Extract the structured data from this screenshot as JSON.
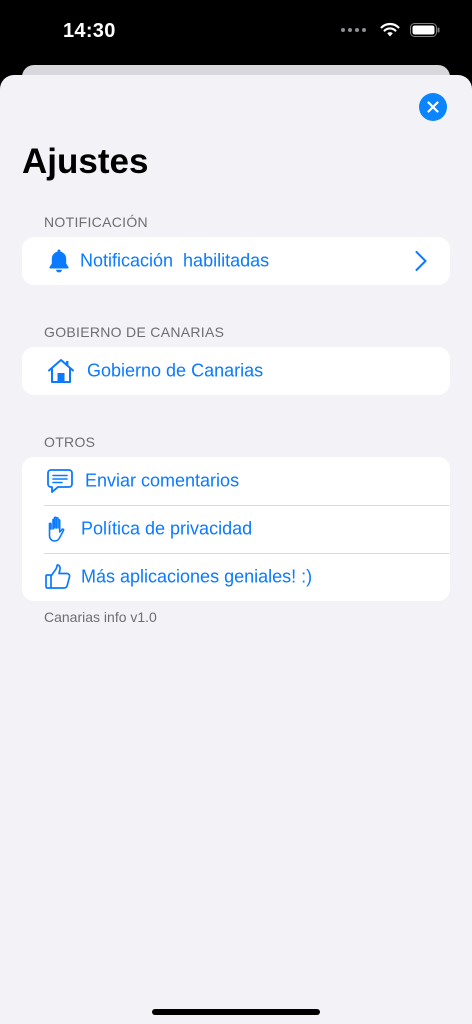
{
  "status_bar": {
    "time": "14:30"
  },
  "header": {
    "title": "Ajustes",
    "close_icon": "close-icon"
  },
  "sections": {
    "notification": {
      "header": "NOTIFICACIÓN",
      "row_label": "Notificación  habilitadas",
      "icon": "bell-icon"
    },
    "government": {
      "header": "GOBIERNO DE CANARIAS",
      "row_label": "Gobierno de Canarias",
      "icon": "house-icon"
    },
    "others": {
      "header": "OTROS",
      "rows": [
        {
          "label": "Enviar comentarios",
          "icon": "message-icon"
        },
        {
          "label": "Política de privacidad",
          "icon": "hand-icon"
        },
        {
          "label": "Más aplicaciones geniales! :)",
          "icon": "thumbs-up-icon"
        }
      ]
    }
  },
  "footer": {
    "version": "Canarias info v1.0"
  },
  "colors": {
    "accent": "#0a7aff",
    "background": "#f2f2f7",
    "card": "#ffffff",
    "secondary_text": "#6d6d72"
  }
}
